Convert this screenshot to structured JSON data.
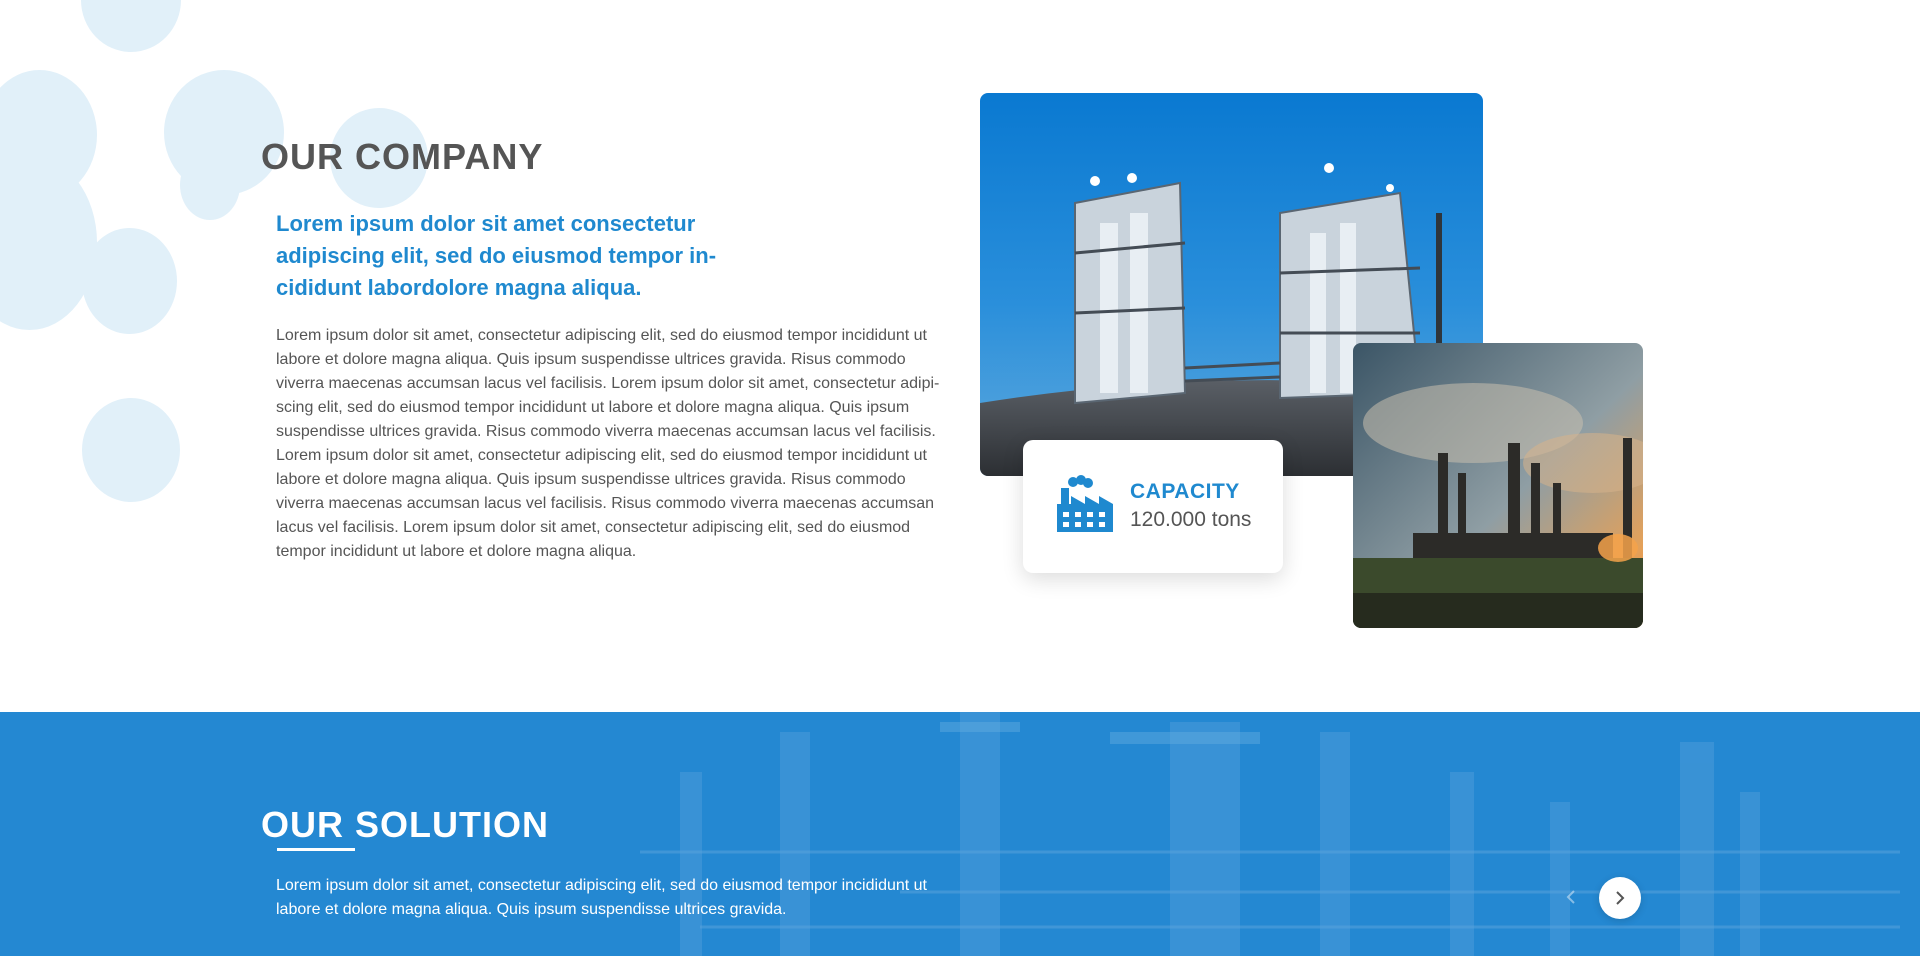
{
  "company": {
    "title": "OUR COMPANY",
    "lead": "Lorem ipsum dolor sit amet consectetur adipiscing elit, sed do eiusmod tempor in-cididunt labordolore magna aliqua.",
    "body": "Lorem ipsum dolor sit amet, consectetur adipiscing elit, sed do eiusmod tempor incididunt ut labore et dolore magna aliqua. Quis ipsum suspendisse ultrices gravida. Risus commodo viverra maecenas accumsan lacus vel facilisis. Lorem ipsum dolor sit amet, consectetur adipi-scing elit, sed do eiusmod tempor incididunt ut labore et dolore magna aliqua. Quis ipsum suspendisse ultrices gravida. Risus commodo viverra maecenas accumsan lacus vel facilisis. Lorem ipsum dolor sit amet, consectetur adipiscing elit, sed do eiusmod tempor incididunt ut labore et dolore magna aliqua. Quis ipsum suspendisse ultrices gravida. Risus commodo viverra maecenas accumsan lacus vel facilisis. Risus commodo viverra maecenas accumsan lacus vel facilisis. Lorem ipsum dolor sit amet, consectetur adipiscing elit, sed do eiusmod tempor incididunt ut labore et dolore magna aliqua."
  },
  "capacity": {
    "icon": "factory-icon",
    "label": "CAPACITY",
    "value": "120.000 tons"
  },
  "solution": {
    "title": "OUR SOLUTION",
    "text": "Lorem ipsum dolor sit amet, consectetur adipiscing elit, sed do eiusmod tempor incididunt ut labore et dolore magna aliqua. Quis ipsum suspendisse ultrices gravida.",
    "prev_icon": "chevron-left-icon",
    "next_icon": "chevron-right-icon"
  },
  "colors": {
    "accent": "#1f89cf",
    "heading": "#555555",
    "solution_bg": "#2488d2",
    "decor": "#e1f0f9"
  }
}
